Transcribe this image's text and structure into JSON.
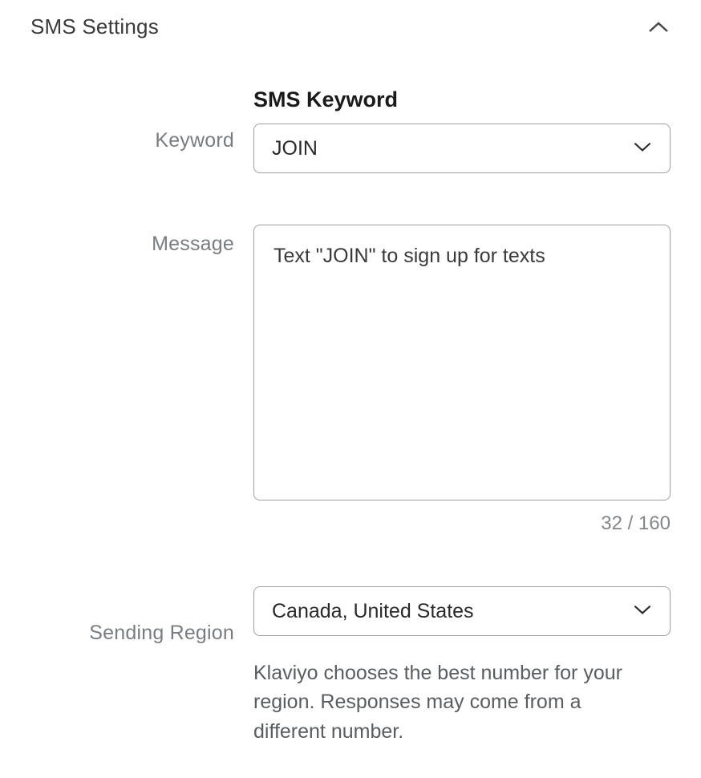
{
  "section": {
    "title": "SMS Settings"
  },
  "keyword": {
    "label": "Keyword",
    "heading": "SMS Keyword",
    "value": "JOIN"
  },
  "message": {
    "label": "Message",
    "value": "Text \"JOIN\" to sign up for texts",
    "counter": "32 / 160"
  },
  "region": {
    "label": "Sending Region",
    "value": "Canada, United States",
    "help": "Klaviyo chooses the best number for your region. Responses may come from a different number."
  }
}
